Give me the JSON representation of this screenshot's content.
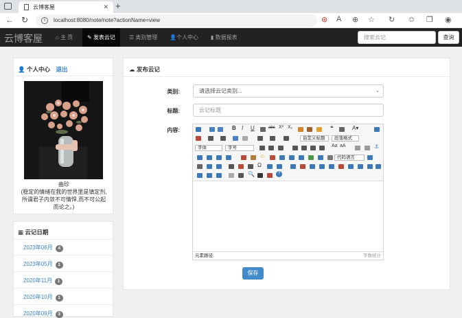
{
  "browser": {
    "tab_title": "云博客屋",
    "url": "localhost:8080/note/note?actionName=view",
    "new_tab": "+"
  },
  "navbar": {
    "brand": "云博客屋",
    "items": [
      {
        "label": "主 页",
        "icon": "home-icon"
      },
      {
        "label": "发表云记",
        "icon": "pencil-icon",
        "active": true
      },
      {
        "label": "类别管理",
        "icon": "list-icon"
      },
      {
        "label": "个人中心",
        "icon": "user-icon"
      },
      {
        "label": "数据报表",
        "icon": "chart-icon"
      }
    ],
    "search_placeholder": "搜索云记",
    "search_button": "查询"
  },
  "profile": {
    "title": "个人中心",
    "logout": "退出",
    "nickname": "曲珍",
    "mood_line1": "(稳定的情绪在我的世界里是镇定剂,",
    "mood_line2": "所谓君子内敛不可情悍,而不可公起",
    "mood_line3": "而论之。)"
  },
  "dates": {
    "title": "云记日期",
    "items": [
      {
        "label": "2023年06月",
        "count": "4"
      },
      {
        "label": "2023年05月",
        "count": "1"
      },
      {
        "label": "2020年11月",
        "count": "1"
      },
      {
        "label": "2020年10月",
        "count": "1"
      },
      {
        "label": "2020年09月",
        "count": "3"
      }
    ]
  },
  "form": {
    "title": "发布云记",
    "category_label": "类别:",
    "category_value": "请选择云记类别...",
    "title_label": "标题:",
    "title_placeholder": "云记标题",
    "content_label": "内容:",
    "save_button": "保存"
  },
  "editor": {
    "dd_custom_title": "自定义标题",
    "dd_paragraph": "段落格式",
    "dd_font": "字体",
    "dd_size": "字号",
    "dd_code": "代码语言",
    "footer_path": "元素路径:",
    "footer_count": "字数统计"
  },
  "colors": {
    "accent": "#428bca",
    "link": "#3a84c8",
    "nav_bg": "#222222"
  }
}
